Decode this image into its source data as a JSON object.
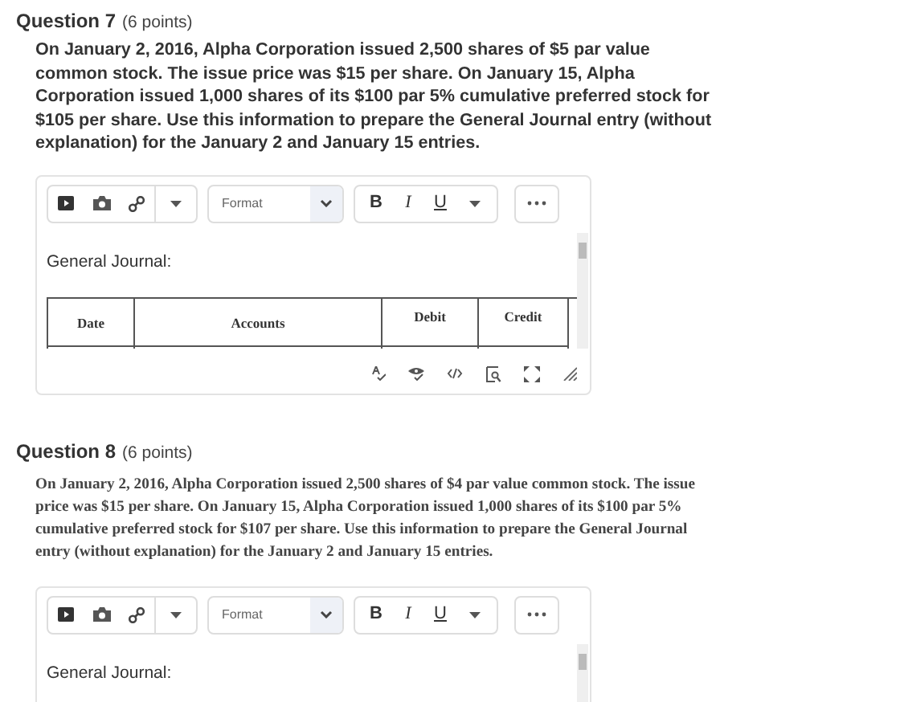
{
  "questions": [
    {
      "title": "Question 7",
      "points": "(6 points)",
      "kind": "sans",
      "body": "On January 2, 2016, Alpha Corporation issued 2,500 shares of $5 par value common stock. The issue price was $15 per share. On January 15, Alpha Corporation issued 1,000 shares of its $100 par 5% cumulative preferred stock for $105 per share. Use this information to prepare the General Journal entry (without explanation) for the January 2 and January 15 entries.",
      "editor": {
        "format_placeholder": "Format",
        "style_buttons": [
          "B",
          "I",
          "U"
        ],
        "heading": "General Journal:",
        "table": {
          "columns": [
            "Date",
            "Accounts",
            "Debit",
            "Credit"
          ]
        }
      }
    },
    {
      "title": "Question 8",
      "points": "(6 points)",
      "kind": "serif",
      "body": "On January 2, 2016, Alpha Corporation issued 2,500 shares of $4 par value common stock. The issue price was $15 per share. On January 15, Alpha Corporation issued 1,000 shares of its $100 par 5% cumulative preferred stock for $107 per share. Use this information to prepare the General Journal entry (without explanation) for the January 2 and January 15 entries.",
      "editor": {
        "format_placeholder": "Format",
        "style_buttons": [
          "B",
          "I",
          "U"
        ],
        "heading": "General Journal:"
      }
    }
  ]
}
